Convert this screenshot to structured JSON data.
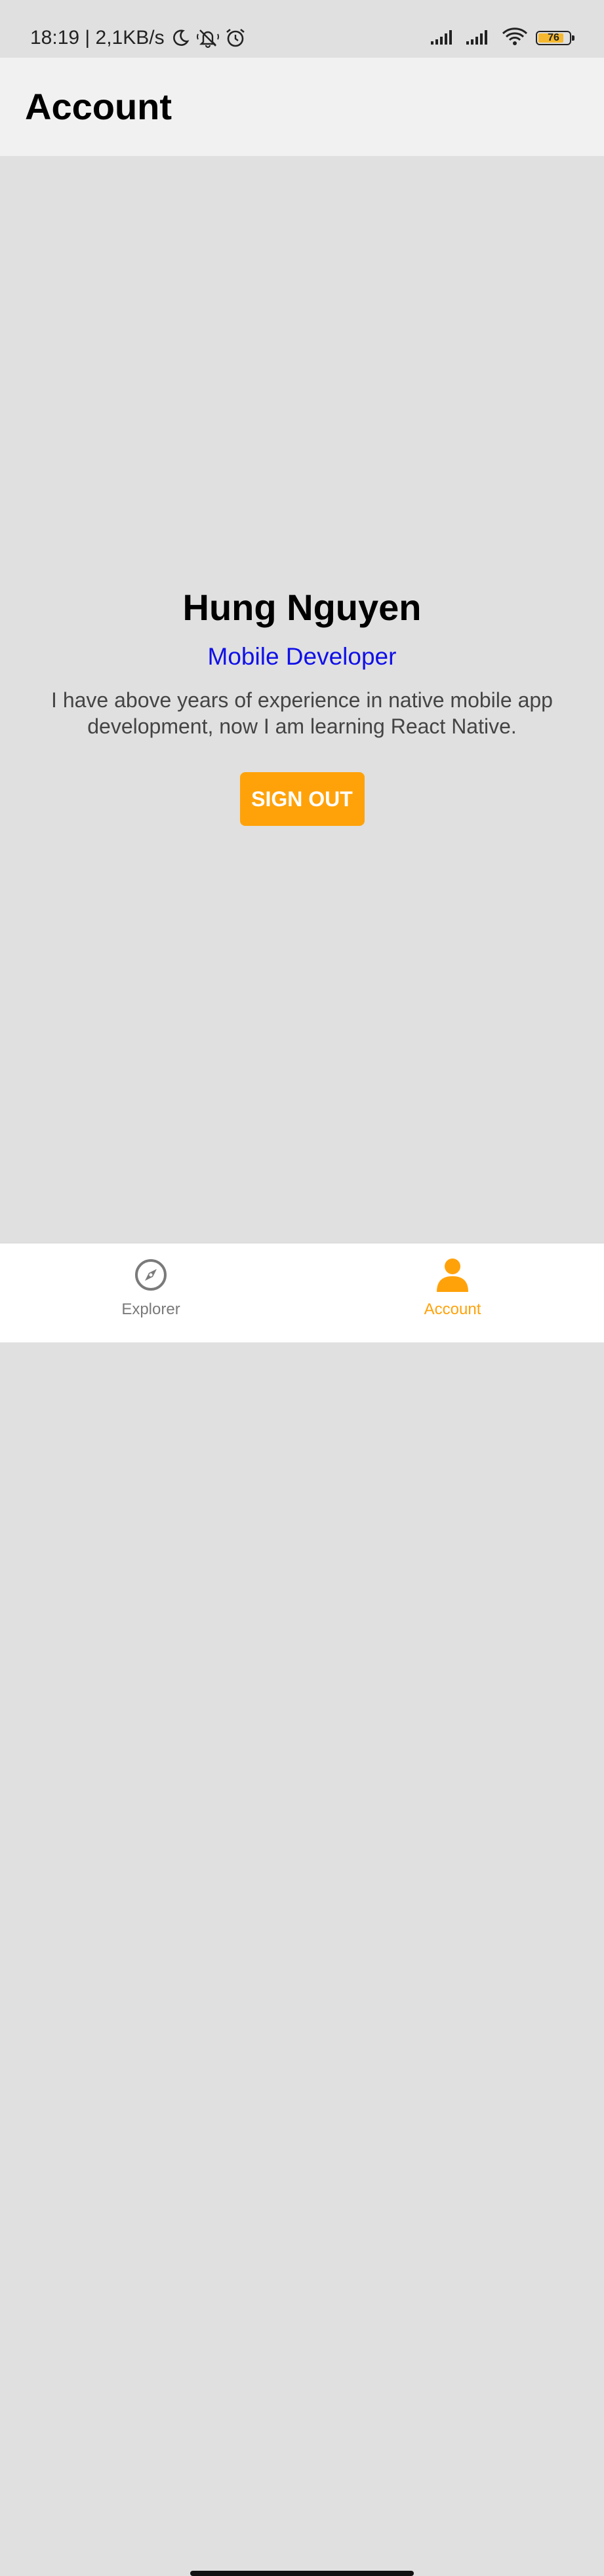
{
  "status_bar": {
    "time_speed": "18:19 | 2,1KB/s",
    "icons": [
      "moon-icon",
      "bell-off-icon",
      "alarm-icon",
      "signal-icon",
      "signal-icon",
      "wifi-icon",
      "battery-icon"
    ],
    "battery_level": "76"
  },
  "header": {
    "title": "Account"
  },
  "profile": {
    "name": "Hung Nguyen",
    "role": "Mobile Developer",
    "bio": "I have above years of experience in native mobile app development, now I am learning React Native.",
    "sign_out_label": "SIGN OUT"
  },
  "tabbar": {
    "tabs": [
      {
        "label": "Explorer",
        "icon": "compass-icon",
        "active": false
      },
      {
        "label": "Account",
        "icon": "person-icon",
        "active": true
      }
    ]
  },
  "colors": {
    "accent": "#ffa20a",
    "role_text": "#1010e8",
    "background": "#e0e0e0",
    "header_bg": "#f1f1f1"
  }
}
